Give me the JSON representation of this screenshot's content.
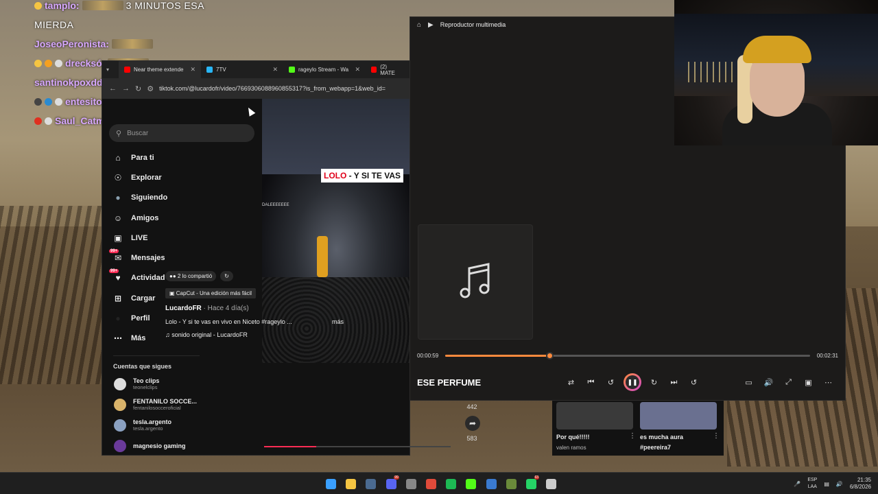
{
  "chat": {
    "top_text": "3 MINUTOS ESA",
    "top_user": "tamplo:",
    "line2": "MIERDA",
    "users": [
      {
        "name": "JoseoPeronista:",
        "color": "#d8a8ff"
      },
      {
        "name": "drecksó:",
        "color": "#d8a8ff"
      },
      {
        "name": "santinokpoxdd:",
        "color": "#d8a8ff"
      },
      {
        "name": "entesito:",
        "color": "#d8a8ff"
      },
      {
        "name": "Saul_Catman:",
        "color": "#c8a8ff"
      }
    ]
  },
  "browser": {
    "tabs": [
      {
        "label": "Near theme extende",
        "color": "#ff0000"
      },
      {
        "label": "7TV",
        "color": "#29b6f6"
      },
      {
        "label": "rageylo Stream - Wa",
        "color": "#53fc18"
      },
      {
        "label": "(2) MATE",
        "color": "#ff0000"
      }
    ],
    "url": "tiktok.com/@lucardofr/video/7669306088960855317?is_from_webapp=1&web_id="
  },
  "tiktok": {
    "search_placeholder": "Buscar",
    "nav": [
      {
        "label": "Para ti",
        "icon": "home-icon",
        "glyph": "⌂"
      },
      {
        "label": "Explorar",
        "icon": "compass-icon",
        "glyph": "☉"
      },
      {
        "label": "Siguiendo",
        "icon": "avatar-icon",
        "glyph": "●"
      },
      {
        "label": "Amigos",
        "icon": "people-icon",
        "glyph": "☺"
      },
      {
        "label": "LIVE",
        "icon": "live-icon",
        "glyph": "▣"
      },
      {
        "label": "Mensajes",
        "icon": "message-icon",
        "glyph": "✉",
        "badge": "99+"
      },
      {
        "label": "Actividad",
        "icon": "bell-icon",
        "glyph": "♥",
        "badge": "99+"
      },
      {
        "label": "Cargar",
        "icon": "upload-icon",
        "glyph": "⊞"
      },
      {
        "label": "Perfil",
        "icon": "profile-icon",
        "glyph": "●"
      },
      {
        "label": "Más",
        "icon": "more-icon",
        "glyph": "⋯"
      }
    ],
    "following_title": "Cuentas que sigues",
    "following": [
      {
        "name": "Teo clips",
        "handle": "teonelclips",
        "color": "#dddddd"
      },
      {
        "name": "FENTANILO SOCCE...",
        "handle": "fentanilosocceroficial",
        "color": "#d9b36a"
      },
      {
        "name": "tesla.argento",
        "handle": "tesla.argento",
        "color": "#8aa0c0"
      },
      {
        "name": "magnesio gaming",
        "handle": "",
        "color": "#6a3a9a"
      }
    ],
    "video": {
      "overlay_red": "LOLO",
      "overlay_rest": " - Y SI TE VAS",
      "small_label": "DALEEEEEEE",
      "shared_chip": "2 lo compartió",
      "capcut": "CapCut - Una edición más fácil",
      "author": "LucardoFR",
      "time": " · Hace 4 día(s)",
      "caption": "Lolo - Y si te vas en vivo en Niceto #rageylo ...",
      "more": "más",
      "sound": "sonido original - LucardoFR",
      "count_top": "442",
      "count_share": "583",
      "progress": 0.28
    },
    "thumbs": [
      {
        "title": "Por qué!!!!!",
        "sub": "valen ramos",
        "color": "#3a3a3a"
      },
      {
        "title": "es mucha aura",
        "sub": "#peereira7",
        "color": "#6a7090"
      }
    ]
  },
  "player": {
    "title": "Reproductor multimedia",
    "track": "ESE PERFUME",
    "elapsed": "00:00:59",
    "total": "00:02:31",
    "progress": 0.285
  },
  "taskbar": {
    "lang_top": "ESP",
    "lang_bottom": "LAA",
    "time": "21:35",
    "date": "6/8/2026",
    "apps": [
      {
        "name": "windows-start-icon",
        "color": "#3aa0ff",
        "notif": ""
      },
      {
        "name": "file-explorer-icon",
        "color": "#f5c542",
        "notif": ""
      },
      {
        "name": "steam-icon",
        "color": "#4a6a90",
        "notif": ""
      },
      {
        "name": "discord-icon",
        "color": "#5865f2",
        "notif": "99"
      },
      {
        "name": "settings-icon",
        "color": "#888888",
        "notif": ""
      },
      {
        "name": "chrome-icon",
        "color": "#e04a3a",
        "notif": ""
      },
      {
        "name": "spotify-icon",
        "color": "#1db954",
        "notif": ""
      },
      {
        "name": "kick-icon",
        "color": "#53fc18",
        "notif": ""
      },
      {
        "name": "ccleaner-icon",
        "color": "#3a7ad0",
        "notif": ""
      },
      {
        "name": "minecraft-icon",
        "color": "#6a8a3a",
        "notif": ""
      },
      {
        "name": "whatsapp-icon",
        "color": "#25d366",
        "notif": "63"
      },
      {
        "name": "media-player-icon",
        "color": "#cccccc",
        "notif": ""
      }
    ]
  }
}
